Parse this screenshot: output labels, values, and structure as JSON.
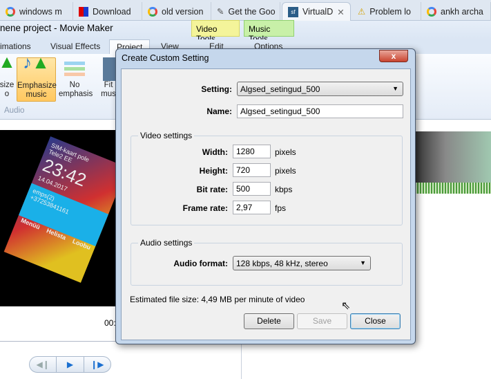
{
  "browser_tabs": [
    {
      "label": "windows m",
      "icon": "google-icon"
    },
    {
      "label": "Download",
      "icon": "download-site-icon"
    },
    {
      "label": "old version",
      "icon": "google-icon"
    },
    {
      "label": "Get the Goo",
      "icon": "tool-icon"
    },
    {
      "label": "VirtualD",
      "icon": "sf-icon",
      "active": true
    },
    {
      "label": "Problem lo",
      "icon": "warning-icon"
    },
    {
      "label": "ankh archa",
      "icon": "google-icon"
    }
  ],
  "app": {
    "title": "nene project - Movie Maker"
  },
  "contextual": {
    "video_tools": "Video Tools",
    "music_tools": "Music Tools",
    "edit": "Edit",
    "options": "Options"
  },
  "ribbon_tabs": [
    "imations",
    "Visual Effects",
    "Project",
    "View"
  ],
  "ribbon": {
    "buttons": [
      {
        "label": "size\no"
      },
      {
        "label": "Emphasize\nmusic",
        "selected": true
      },
      {
        "label": "No\nemphasis"
      },
      {
        "label": "Fit\nmus"
      }
    ],
    "group": "Audio"
  },
  "preview": {
    "time": "00:",
    "phone_texts": [
      "SIM-kaart pole",
      "Tele2 EE",
      "23:42",
      "14.04.2017",
      "emps(2)",
      "+37253841161",
      "Menüü",
      "Helista",
      "Loobu"
    ]
  },
  "dialog": {
    "title": "Create Custom Setting",
    "close": "x",
    "setting_label": "Setting:",
    "setting_value": "Algsed_setingud_500",
    "name_label": "Name:",
    "name_value": "Algsed_setingud_500",
    "video": {
      "title": "Video settings",
      "width_label": "Width:",
      "width": "1280",
      "width_unit": "pixels",
      "height_label": "Height:",
      "height": "720",
      "height_unit": "pixels",
      "bitrate_label": "Bit rate:",
      "bitrate": "500",
      "bitrate_unit": "kbps",
      "framerate_label": "Frame rate:",
      "framerate": "2,97",
      "framerate_unit": "fps"
    },
    "audio": {
      "title": "Audio settings",
      "format_label": "Audio format:",
      "format_value": "128 kbps, 48 kHz, stereo"
    },
    "estimate": "Estimated file size: 4,49 MB per minute of video",
    "delete": "Delete",
    "save": "Save",
    "close_btn": "Close"
  }
}
